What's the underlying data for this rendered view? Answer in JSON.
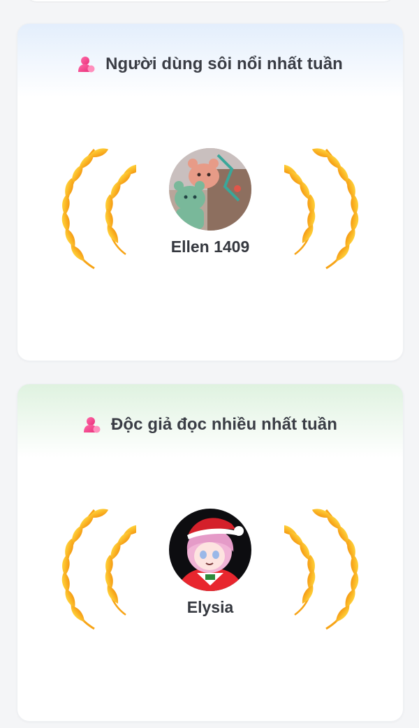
{
  "cards": [
    {
      "title": "Người dùng sôi nổi nhất tuần",
      "icon": "user-icon",
      "user": {
        "name": "Ellen 1409",
        "avatar": "bear-avatar"
      },
      "header_color": "#e3eefc"
    },
    {
      "title": "Độc giả đọc nhiều nhất tuần",
      "icon": "user-icon",
      "user": {
        "name": "Elysia",
        "avatar": "anime-santa-avatar"
      },
      "header_color": "#dff2e0"
    }
  ],
  "colors": {
    "icon_pink": "#f0448c",
    "laurel_gold": "#f9a81a",
    "text": "#3a3d45"
  }
}
